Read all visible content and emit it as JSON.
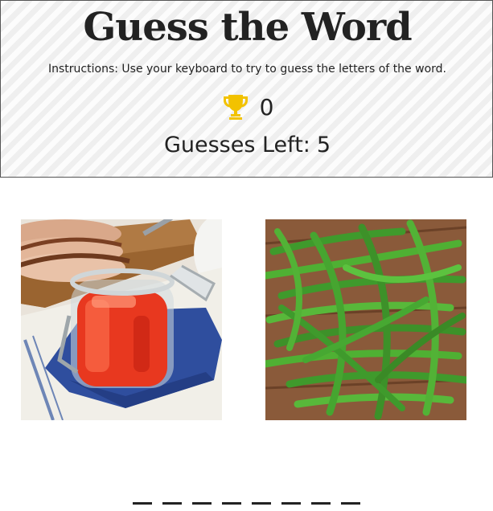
{
  "header": {
    "title": "Guess the Word",
    "instructions": "Instructions: Use your keyboard to try to guess the letters of the word.",
    "score": "0",
    "score_icon": "trophy-icon",
    "guesses_label": "Guesses Left:",
    "guesses_value": "5"
  },
  "colors": {
    "trophy": "#f2c200",
    "text": "#222222",
    "header_bg": "#f5f5f5"
  },
  "clues": [
    {
      "name": "jelly-jar-photo",
      "description": "jar of red jelly on a blue napkin"
    },
    {
      "name": "green-beans-photo",
      "description": "green beans on a wooden surface"
    }
  ],
  "word": {
    "letter_count": 8,
    "revealed": [
      "_",
      "_",
      "_",
      "_",
      "_",
      "_",
      "_",
      "_"
    ]
  }
}
